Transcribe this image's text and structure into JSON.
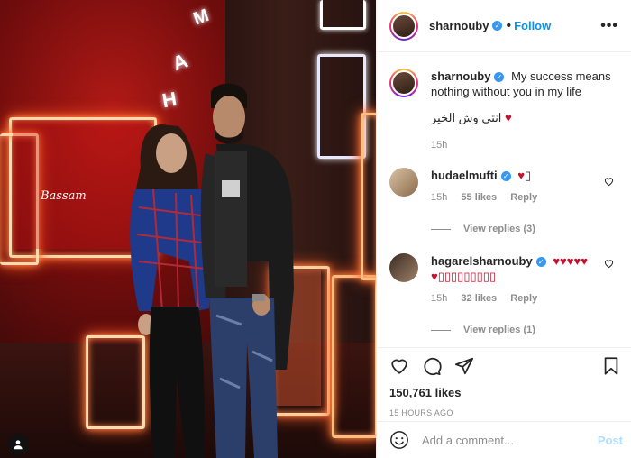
{
  "header": {
    "username": "sharnouby",
    "follow_label": "Follow",
    "more_label": "•••"
  },
  "caption": {
    "username": "sharnouby",
    "text": "My success means nothing without you in my life",
    "arabic_line": "انتي وش الخير",
    "heart": "♥",
    "age": "15h"
  },
  "comments": [
    {
      "username": "hudaelmufti",
      "text": "♥",
      "trail": "▯",
      "age": "15h",
      "likes": "55 likes",
      "reply_label": "Reply",
      "view_replies": "View replies (3)"
    },
    {
      "username": "hagarelsharnouby",
      "text": "♥♥♥♥♥",
      "text2": "♥▯▯▯▯▯▯▯▯▯",
      "age": "15h",
      "likes": "32 likes",
      "reply_label": "Reply",
      "view_replies": "View replies (1)"
    }
  ],
  "footer": {
    "likes": "150,761 likes",
    "timestamp": "15 HOURS AGO",
    "comment_placeholder": "Add a comment...",
    "post_label": "Post"
  },
  "photo": {
    "neon_letters": [
      "M",
      "A",
      "H"
    ],
    "signature": "Bassam"
  },
  "colors": {
    "accent": "#0095f6",
    "verified": "#3897f0",
    "heart_red": "#c8102e"
  }
}
